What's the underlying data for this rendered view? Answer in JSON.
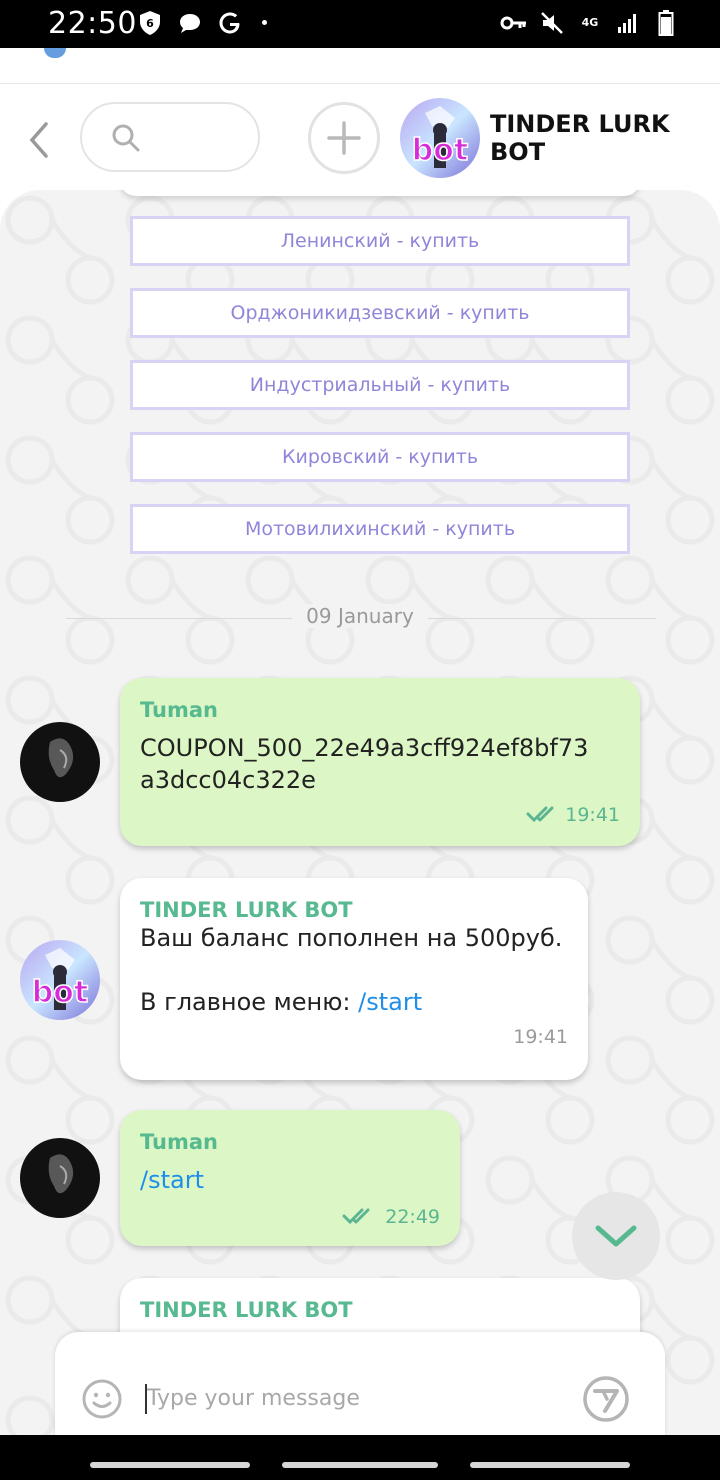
{
  "status_bar": {
    "time": "22:50",
    "network": "4G",
    "icons_left": [
      "shield-icon",
      "chat-bubble-icon",
      "google-icon"
    ],
    "icons_right": [
      "key-icon",
      "mute-icon",
      "signal-icon",
      "battery-icon"
    ]
  },
  "header": {
    "title": "TINDER LURK BOT",
    "avatar_text": "bot",
    "search_icon": "search-icon",
    "back_icon": "chevron-left-icon",
    "add_icon": "plus-icon"
  },
  "keyboard_buttons": [
    {
      "label": "Ленинский - купить"
    },
    {
      "label": "Орджоникидзевский - купить"
    },
    {
      "label": "Индустриальный - купить"
    },
    {
      "label": "Кировский - купить"
    },
    {
      "label": "Мотовилихинский - купить"
    }
  ],
  "date_separator": "09 January",
  "messages": [
    {
      "sender": "Tuman",
      "text_line1": "COUPON_500_22e49a3cff924ef8bf73",
      "text_line2": "a3dcc04c322e",
      "time": "19:41",
      "status": "read"
    },
    {
      "sender": "TINDER LURK BOT",
      "text": "Ваш баланс пополнен на 500руб.",
      "text2_prefix": "В главное меню: ",
      "text2_link": "/start",
      "time": "19:41"
    },
    {
      "sender": "Tuman",
      "text_link": "/start",
      "time": "22:49",
      "status": "read"
    },
    {
      "sender": "TINDER LURK BOT"
    }
  ],
  "input": {
    "placeholder": "Type your message",
    "value": ""
  },
  "colors": {
    "accent_green": "#56b990",
    "outgoing_bubble": "#dcf7c5",
    "keyboard_text": "#8f86da",
    "link": "#1f8ee8"
  }
}
